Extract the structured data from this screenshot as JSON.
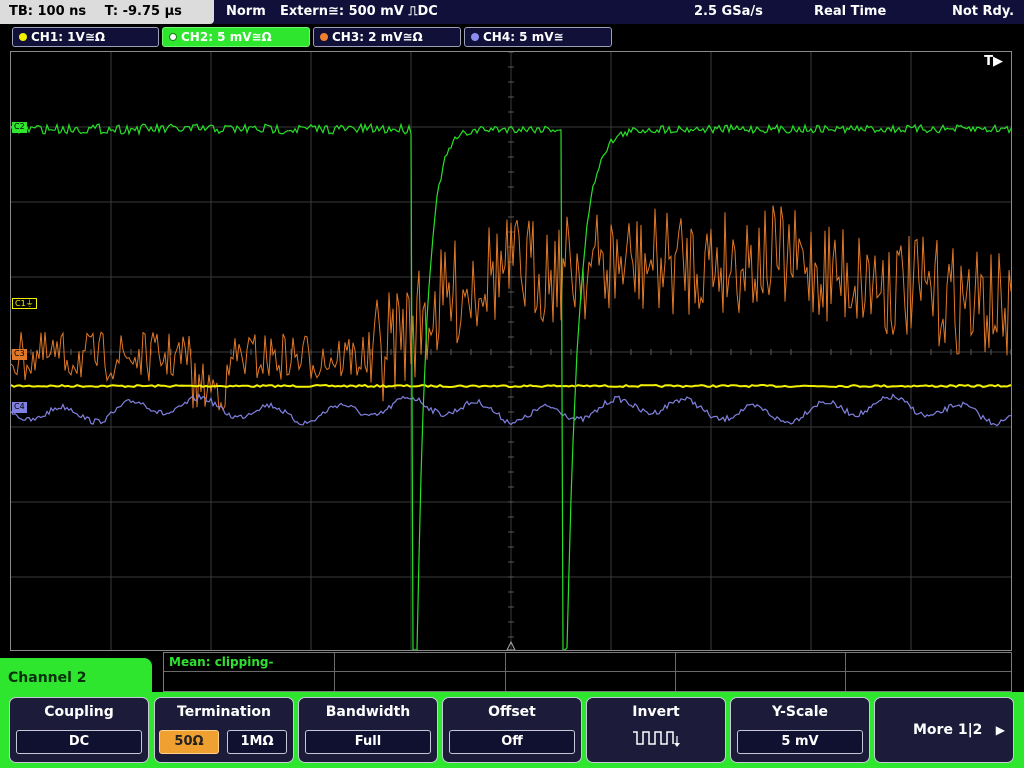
{
  "status": {
    "timebase": "TB: 100 ns",
    "trigger_offset": "T: -9.75 µs",
    "trigger_mode": "Norm",
    "trigger_source": "Extern≅: 500 mV ⎍DC",
    "sample_rate": "2.5 GSa/s",
    "acq_mode": "Real Time",
    "ready_state": "Not Rdy."
  },
  "channels": [
    {
      "label": "CH1: 1V≅Ω",
      "color": "#f2f200"
    },
    {
      "label": "CH2: 5 mV≅Ω",
      "color": "#2ee62e"
    },
    {
      "label": "CH3: 2 mV≅Ω",
      "color": "#f08030"
    },
    {
      "label": "CH4: 5 mV≅",
      "color": "#8c8cf0"
    }
  ],
  "markers": {
    "c1": "C1⏚",
    "c2": "C2",
    "c3": "C3",
    "c4": "C4",
    "trigger_pos": "T▶"
  },
  "measurement": {
    "text": "Mean: clipping-"
  },
  "menu": {
    "title": "Channel 2",
    "coupling": {
      "label": "Coupling",
      "value": "DC"
    },
    "termination": {
      "label": "Termination",
      "opt1": "50Ω",
      "opt2": "1MΩ"
    },
    "bandwidth": {
      "label": "Bandwidth",
      "value": "Full"
    },
    "offset": {
      "label": "Offset",
      "value": "Off"
    },
    "invert": {
      "label": "Invert",
      "icon": "inverted-square-wave-icon"
    },
    "yscale": {
      "label": "Y-Scale",
      "value": "5 mV"
    },
    "more": {
      "label": "More 1|2"
    }
  }
}
